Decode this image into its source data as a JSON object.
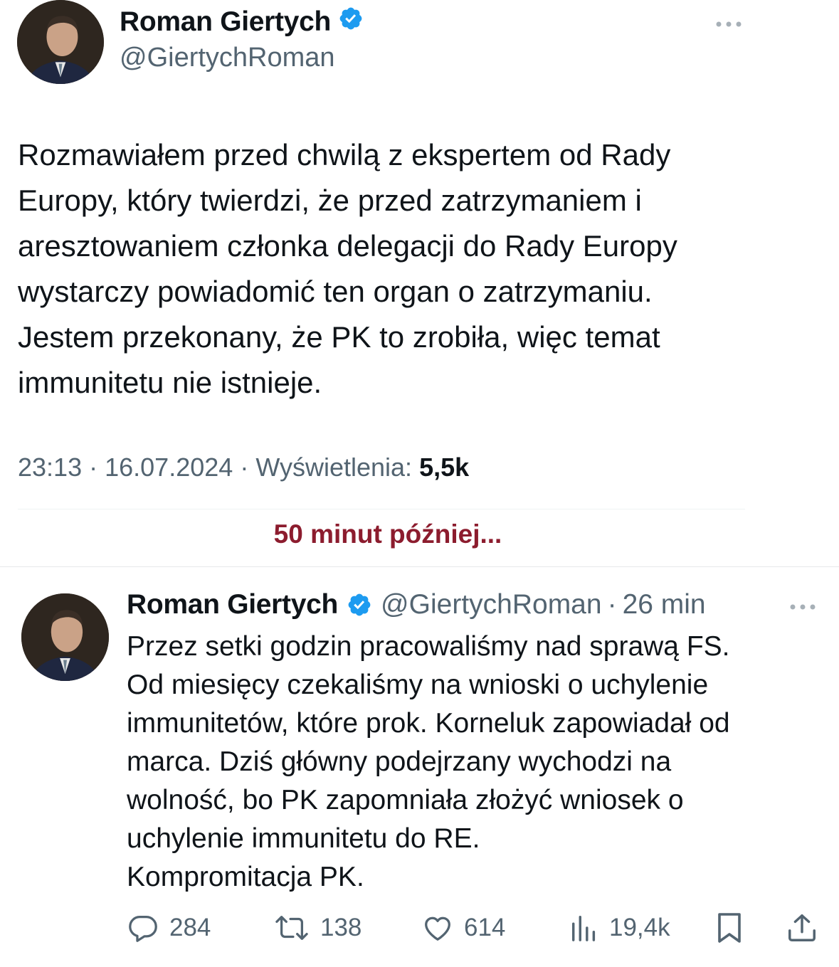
{
  "tweet1": {
    "author_name": "Roman Giertych",
    "handle": "@GiertychRoman",
    "text": "Rozmawiałem przed chwilą z ekspertem od Rady\nEuropy, który twierdzi, że przed zatrzymaniem i\naresztowaniem członka delegacji do Rady Europy\nwystarczy powiadomić ten organ o zatrzymaniu.\nJestem przekonany, że PK to zrobiła, więc temat\nimmunitetu nie istnieje.",
    "time": "23:13",
    "date": "16.07.2024",
    "views_label": "Wyświetlenia:",
    "views": "5,5k"
  },
  "separator_text": "50 minut później...",
  "tweet2": {
    "author_name": "Roman Giertych",
    "handle": "@GiertychRoman",
    "time": "26 min",
    "text": "Przez setki godzin pracowaliśmy nad sprawą FS.\nOd miesięcy czekaliśmy na wnioski o uchylenie\nimmunitetów, które prok. Korneluk zapowiadał od\nmarca. Dziś główny podejrzany wychodzi na\nwolność, bo PK zapomniała złożyć wniosek o\nuchylenie immunitetu do RE.\nKompromitacja PK.",
    "replies": "284",
    "retweets": "138",
    "likes": "614",
    "views": "19,4k"
  },
  "colors": {
    "verified_badge": "#1d9bf0",
    "secondary_text": "#536471",
    "separator_text": "#8c1c2e"
  },
  "icons": [
    "verified-badge-icon",
    "more-icon",
    "reply-icon",
    "retweet-icon",
    "like-icon",
    "views-icon",
    "bookmark-icon",
    "share-icon"
  ]
}
